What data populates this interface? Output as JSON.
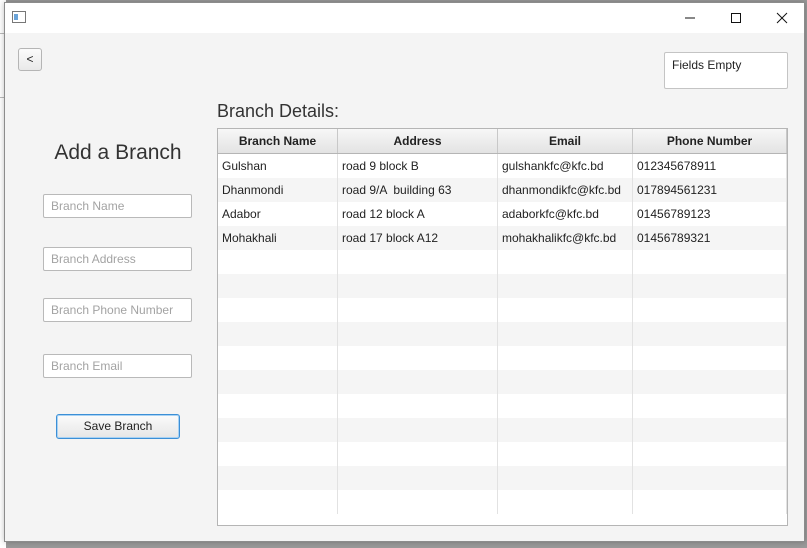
{
  "window": {
    "controls": [
      "minimize-icon",
      "maximize-icon",
      "close-icon"
    ]
  },
  "toolbar": {
    "back_label": "<"
  },
  "status": {
    "message": "Fields Empty"
  },
  "form": {
    "title": "Add a Branch",
    "fields": [
      {
        "placeholder": "Branch Name",
        "value": ""
      },
      {
        "placeholder": "Branch Address",
        "value": ""
      },
      {
        "placeholder": "Branch Phone Number",
        "value": ""
      },
      {
        "placeholder": "Branch Email",
        "value": ""
      }
    ],
    "save_label": "Save Branch"
  },
  "table": {
    "title": "Branch Details:",
    "columns": [
      "Branch Name",
      "Address",
      "Email",
      "Phone Number"
    ],
    "rows": [
      [
        "Gulshan",
        "road 9 block B",
        "gulshankfc@kfc.bd",
        "012345678911"
      ],
      [
        "Dhanmondi",
        "road 9/A  building 63",
        "dhanmondikfc@kfc.bd",
        "017894561231"
      ],
      [
        "Adabor",
        "road 12 block A",
        "adaborkfc@kfc.bd",
        "01456789123"
      ],
      [
        "Mohakhali",
        "road 17 block A12",
        "mohakhalikfc@kfc.bd",
        "01456789321"
      ]
    ],
    "empty_rows": 11
  }
}
